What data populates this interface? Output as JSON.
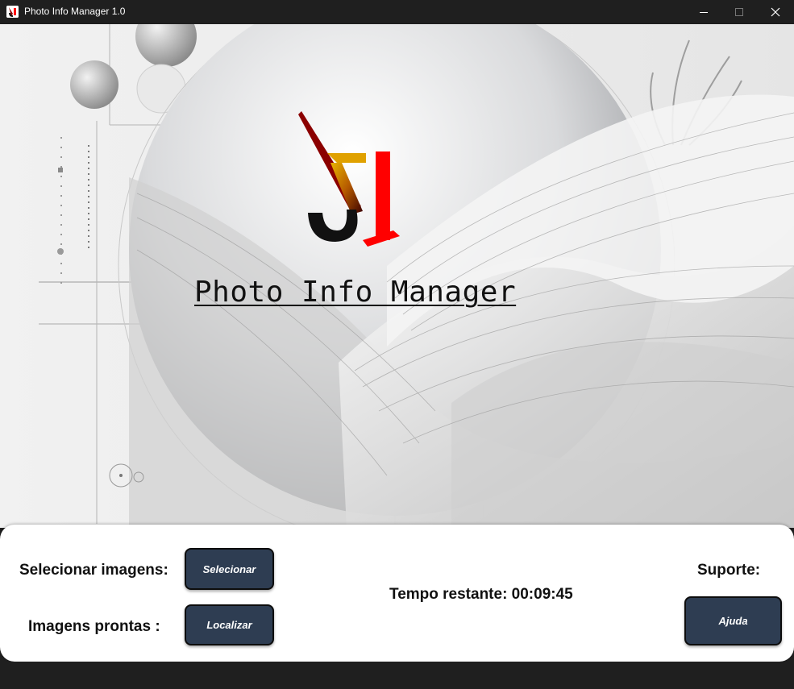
{
  "window": {
    "title": "Photo Info Manager 1.0",
    "icons": [
      "app-logo-icon",
      "minimize-icon",
      "maximize-icon",
      "close-icon"
    ]
  },
  "hero": {
    "title": "Photo Info Manager",
    "logo_colors": [
      "#1a1a1a",
      "#e8b400",
      "#ff0000",
      "#8b0000"
    ]
  },
  "panel": {
    "select_label": "Selecionar  imagens:",
    "select_button": "Selecionar",
    "ready_label": "Imagens prontas :",
    "locate_button": "Localizar",
    "timer": "Tempo restante: 00:09:45",
    "support_label": "Suporte:",
    "help_button": "Ajuda"
  },
  "colors": {
    "button_bg": "#2e3d52",
    "titlebar_bg": "#1f1f1f",
    "panel_bg": "#ffffff"
  }
}
